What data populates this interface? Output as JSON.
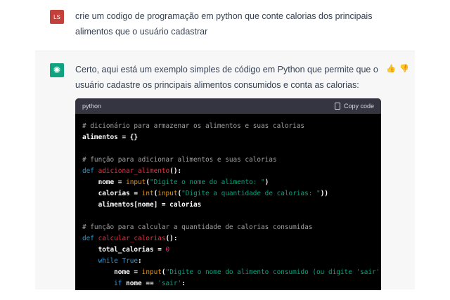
{
  "user": {
    "initials": "LS",
    "message": "crie um codigo de programação em python que conte calorias dos principais alimentos que o usuário cadastrar"
  },
  "assistant": {
    "message": "Certo, aqui está um exemplo simples de código em Python que permite que o usuário cadastre os principais alimentos consumidos e conta as calorias:",
    "thumbs_up": "👍",
    "thumbs_down": "👎"
  },
  "code": {
    "language": "python",
    "copy_label": "Copy code",
    "lines": [
      [
        [
          "c",
          "# dicionário para armazenar os alimentos e suas calorias"
        ]
      ],
      [
        [
          "p",
          "alimentos = {}"
        ]
      ],
      [],
      [
        [
          "c",
          "# função para adicionar alimentos e suas calorias"
        ]
      ],
      [
        [
          "k",
          "def "
        ],
        [
          "f",
          "adicionar_alimento"
        ],
        [
          "p",
          "():"
        ]
      ],
      [
        [
          "p",
          "    nome = "
        ],
        [
          "b",
          "input"
        ],
        [
          "p",
          "("
        ],
        [
          "s",
          "\"Digite o nome do alimento: \""
        ],
        [
          "p",
          ")"
        ]
      ],
      [
        [
          "p",
          "    calorias = "
        ],
        [
          "b",
          "int"
        ],
        [
          "p",
          "("
        ],
        [
          "b",
          "input"
        ],
        [
          "p",
          "("
        ],
        [
          "s",
          "\"Digite a quantidade de calorias: \""
        ],
        [
          "p",
          "))"
        ]
      ],
      [
        [
          "p",
          "    alimentos[nome] = calorias"
        ]
      ],
      [],
      [
        [
          "c",
          "# função para calcular a quantidade de calorias consumidas"
        ]
      ],
      [
        [
          "k",
          "def "
        ],
        [
          "f",
          "calcular_calorias"
        ],
        [
          "p",
          "():"
        ]
      ],
      [
        [
          "p",
          "    total_calorias = "
        ],
        [
          "n",
          "0"
        ]
      ],
      [
        [
          "k",
          "    while True"
        ],
        [
          "p",
          ":"
        ]
      ],
      [
        [
          "p",
          "        nome = "
        ],
        [
          "b",
          "input"
        ],
        [
          "p",
          "("
        ],
        [
          "s",
          "\"Digite o nome do alimento consumido (ou digite 'sair' para sair)"
        ]
      ],
      [
        [
          "k",
          "        if "
        ],
        [
          "p",
          "nome == "
        ],
        [
          "s",
          "'sair'"
        ],
        [
          "p",
          ":"
        ]
      ]
    ]
  }
}
